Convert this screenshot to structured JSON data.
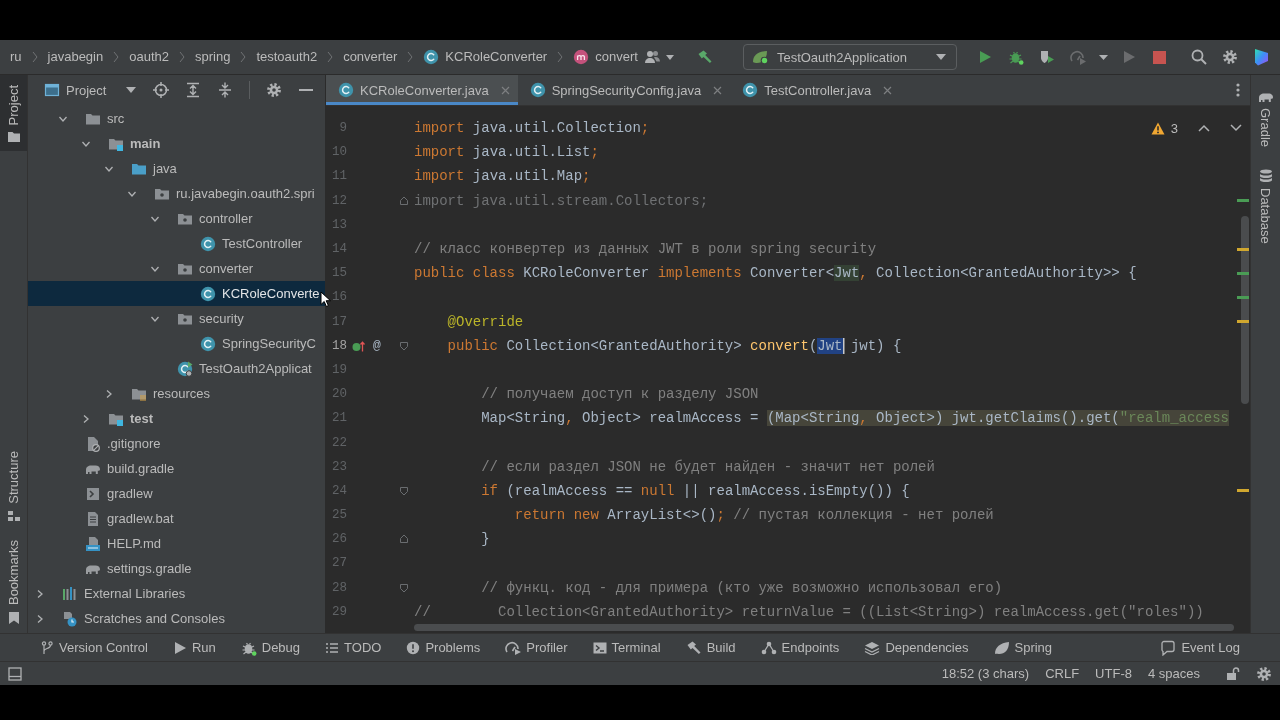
{
  "navigation_bar": {
    "breadcrumbs": [
      {
        "label": "ru",
        "kind": "package"
      },
      {
        "label": "javabegin",
        "kind": "package"
      },
      {
        "label": "oauth2",
        "kind": "package"
      },
      {
        "label": "spring",
        "kind": "package"
      },
      {
        "label": "testoauth2",
        "kind": "package"
      },
      {
        "label": "converter",
        "kind": "package"
      },
      {
        "label": "KCRoleConverter",
        "kind": "class"
      },
      {
        "label": "convert",
        "kind": "method"
      }
    ],
    "toolbar": [
      {
        "kind": "vcs-user",
        "disabled": false
      },
      {
        "kind": "build",
        "disabled": false
      },
      {
        "kind": "run-configuration",
        "label": "TestOauth2Application",
        "disabled": false
      },
      {
        "kind": "run",
        "disabled": false
      },
      {
        "kind": "debug",
        "disabled": false
      },
      {
        "kind": "coverage",
        "disabled": false
      },
      {
        "kind": "profile",
        "disabled": true
      },
      {
        "kind": "more",
        "disabled": false
      },
      {
        "kind": "attach",
        "disabled": true
      },
      {
        "kind": "stop",
        "disabled": false
      },
      {
        "kind": "search",
        "disabled": false
      },
      {
        "kind": "settings",
        "disabled": false
      },
      {
        "kind": "toolbox",
        "disabled": false
      }
    ]
  },
  "left_stripe": {
    "top": [
      {
        "label": "Project",
        "kind": "project",
        "selected": true
      }
    ],
    "bottom": [
      {
        "label": "Structure",
        "kind": "structure",
        "selected": false
      },
      {
        "label": "Bookmarks",
        "kind": "bookmarks",
        "selected": false
      }
    ]
  },
  "project_panel": {
    "title": "Project",
    "tree": {
      "items": [
        {
          "label": "src",
          "kind": "folder",
          "expanded": true,
          "selected": false,
          "children": [
            {
              "label": "main",
              "kind": "source-set",
              "expanded": true,
              "selected": false,
              "children": [
                {
                  "label": "java",
                  "kind": "java-root",
                  "expanded": true,
                  "selected": false,
                  "children": [
                    {
                      "label": "ru.javabegin.oauth2.spri",
                      "kind": "package",
                      "expanded": true,
                      "selected": false,
                      "children": [
                        {
                          "label": "controller",
                          "kind": "package",
                          "expanded": true,
                          "selected": false,
                          "children": [
                            {
                              "label": "TestController",
                              "kind": "class",
                              "selected": false
                            }
                          ]
                        },
                        {
                          "label": "converter",
                          "kind": "package",
                          "expanded": true,
                          "selected": false,
                          "children": [
                            {
                              "label": "KCRoleConverte",
                              "kind": "class",
                              "selected": true
                            }
                          ]
                        },
                        {
                          "label": "security",
                          "kind": "package",
                          "expanded": true,
                          "selected": false,
                          "children": [
                            {
                              "label": "SpringSecurityC",
                              "kind": "class",
                              "selected": false
                            }
                          ]
                        },
                        {
                          "label": "TestOauth2Applicat",
                          "kind": "app-class",
                          "selected": false
                        }
                      ]
                    }
                  ]
                },
                {
                  "label": "resources",
                  "kind": "resources-root",
                  "expanded": false,
                  "selected": false
                }
              ]
            },
            {
              "label": "test",
              "kind": "source-set",
              "expanded": false,
              "selected": false
            }
          ]
        },
        {
          "label": ".gitignore",
          "kind": "gitignore",
          "selected": false
        },
        {
          "label": "build.gradle",
          "kind": "gradle",
          "selected": false
        },
        {
          "label": "gradlew",
          "kind": "shell",
          "selected": false
        },
        {
          "label": "gradlew.bat",
          "kind": "batch",
          "selected": false
        },
        {
          "label": "HELP.md",
          "kind": "markdown",
          "selected": false
        },
        {
          "label": "settings.gradle",
          "kind": "gradle",
          "selected": false
        }
      ],
      "top_level": [
        {
          "label": "External Libraries",
          "kind": "libraries",
          "expanded": false,
          "selected": false
        },
        {
          "label": "Scratches and Consoles",
          "kind": "scratches",
          "expanded": false,
          "selected": false
        }
      ]
    }
  },
  "editor": {
    "tabs": [
      {
        "label": "KCRoleConverter.java",
        "selected": true
      },
      {
        "label": "SpringSecurityConfig.java",
        "selected": false
      },
      {
        "label": "TestController.java",
        "selected": false
      }
    ],
    "inspection_widget": {
      "warnings": "3"
    },
    "lines": [
      {
        "number": "9",
        "current": false,
        "tokens": [
          {
            "text": "import",
            "kind": "keyword"
          },
          {
            "text": " java.util.Collection",
            "kind": "plain"
          },
          {
            "text": ";",
            "kind": "keyword"
          }
        ]
      },
      {
        "number": "10",
        "current": false,
        "tokens": [
          {
            "text": "import",
            "kind": "keyword"
          },
          {
            "text": " java.util.List",
            "kind": "plain"
          },
          {
            "text": ";",
            "kind": "keyword"
          }
        ]
      },
      {
        "number": "11",
        "current": false,
        "tokens": [
          {
            "text": "import",
            "kind": "keyword"
          },
          {
            "text": " java.util.Map",
            "kind": "plain"
          },
          {
            "text": ";",
            "kind": "keyword"
          }
        ]
      },
      {
        "number": "12",
        "current": false,
        "fold_marker": {
          "kind": "end"
        },
        "stripe_mark": {
          "kind": "change"
        },
        "tokens": [
          {
            "text": "import java.util.stream.Collectors;",
            "kind": "unused"
          }
        ]
      },
      {
        "number": "13",
        "current": false
      },
      {
        "number": "14",
        "current": false,
        "stripe_mark": {
          "kind": "warning"
        },
        "tokens": [
          {
            "text": "// класс конвертер из данных JWT в роли spring security",
            "kind": "comment"
          }
        ]
      },
      {
        "number": "15",
        "current": false,
        "stripe_mark": {
          "kind": "change"
        },
        "tokens": [
          {
            "text": "public class",
            "kind": "keyword"
          },
          {
            "text": " KCRoleConverter ",
            "kind": "plain"
          },
          {
            "text": "implements",
            "kind": "keyword"
          },
          {
            "text": " Converter<",
            "kind": "plain"
          },
          {
            "text": "Jwt",
            "kind": "plain",
            "highlight": {
              "kind": "usage"
            }
          },
          {
            "text": ",",
            "kind": "keyword"
          },
          {
            "text": " Collection<GrantedAuthority>> {",
            "kind": "plain"
          }
        ]
      },
      {
        "number": "16",
        "current": false,
        "stripe_mark": {
          "kind": "change"
        }
      },
      {
        "number": "17",
        "current": false,
        "stripe_mark": {
          "kind": "warning"
        },
        "tokens": [
          {
            "text": "    @Override",
            "kind": "annotation"
          }
        ]
      },
      {
        "number": "18",
        "current": true,
        "fold_marker": {
          "kind": "start"
        },
        "gutter_icons": [
          {
            "kind": "implements"
          },
          {
            "kind": "glyph",
            "text": "@"
          }
        ],
        "tokens": [
          {
            "text": "    public",
            "kind": "keyword"
          },
          {
            "text": " Collection<GrantedAuthority> ",
            "kind": "plain"
          },
          {
            "text": "convert",
            "kind": "method"
          },
          {
            "text": "(",
            "kind": "plain"
          },
          {
            "text": "Jwt",
            "kind": "plain",
            "highlight": {
              "kind": "selection"
            }
          },
          {
            "text": " jwt) {",
            "kind": "plain"
          }
        ]
      },
      {
        "number": "19",
        "current": false
      },
      {
        "number": "20",
        "current": false,
        "tokens": [
          {
            "text": "        // получаем доступ к разделу JSON",
            "kind": "comment"
          }
        ]
      },
      {
        "number": "21",
        "current": false,
        "tokens": [
          {
            "text": "        Map<String",
            "kind": "plain"
          },
          {
            "text": ",",
            "kind": "keyword"
          },
          {
            "text": " Object> realmAccess = ",
            "kind": "plain"
          },
          {
            "text": "(Map<String",
            "kind": "plain",
            "highlight": {
              "kind": "warning"
            }
          },
          {
            "text": ",",
            "kind": "keyword",
            "highlight": {
              "kind": "warning"
            }
          },
          {
            "text": " Object>) jwt.getClaims().get(",
            "kind": "plain",
            "highlight": {
              "kind": "warning"
            }
          },
          {
            "text": "\"realm_access",
            "kind": "string",
            "highlight": {
              "kind": "warning"
            }
          }
        ]
      },
      {
        "number": "22",
        "current": false
      },
      {
        "number": "23",
        "current": false,
        "tokens": [
          {
            "text": "        // если раздел JSON не будет найден - значит нет ролей",
            "kind": "comment"
          }
        ]
      },
      {
        "number": "24",
        "current": false,
        "fold_marker": {
          "kind": "start"
        },
        "stripe_mark": {
          "kind": "warning"
        },
        "tokens": [
          {
            "text": "        if",
            "kind": "keyword"
          },
          {
            "text": " (realmAccess == ",
            "kind": "plain"
          },
          {
            "text": "null",
            "kind": "keyword"
          },
          {
            "text": " || realmAccess.isEmpty()) {",
            "kind": "plain"
          }
        ]
      },
      {
        "number": "25",
        "current": false,
        "tokens": [
          {
            "text": "            return new",
            "kind": "keyword"
          },
          {
            "text": " ArrayList<>()",
            "kind": "plain"
          },
          {
            "text": ";",
            "kind": "keyword"
          },
          {
            "text": " // пустая коллекция - нет ролей",
            "kind": "comment"
          }
        ]
      },
      {
        "number": "26",
        "current": false,
        "fold_marker": {
          "kind": "end"
        },
        "tokens": [
          {
            "text": "        }",
            "kind": "plain"
          }
        ]
      },
      {
        "number": "27",
        "current": false
      },
      {
        "number": "28",
        "current": false,
        "fold_marker": {
          "kind": "start"
        },
        "tokens": [
          {
            "text": "        // функц. код - для примера (кто уже возможно использовал его)",
            "kind": "comment"
          }
        ]
      },
      {
        "number": "29",
        "current": false,
        "tokens": [
          {
            "text": "//        Collection<GrantedAuthority> returnValue = ((List<String>) realmAccess.get(\"roles\"))",
            "kind": "comment"
          }
        ]
      }
    ]
  },
  "right_stripe": [
    {
      "label": "Gradle",
      "kind": "gradle",
      "selected": false
    },
    {
      "label": "Database",
      "kind": "database",
      "selected": false
    }
  ],
  "tool_window_bar": {
    "left": [
      {
        "label": "Version Control",
        "kind": "vcs"
      },
      {
        "label": "Run",
        "kind": "run"
      },
      {
        "label": "Debug",
        "kind": "debug"
      },
      {
        "label": "TODO",
        "kind": "todo"
      },
      {
        "label": "Problems",
        "kind": "problems"
      },
      {
        "label": "Profiler",
        "kind": "profiler"
      },
      {
        "label": "Terminal",
        "kind": "terminal"
      },
      {
        "label": "Build",
        "kind": "build"
      },
      {
        "label": "Endpoints",
        "kind": "endpoints"
      },
      {
        "label": "Dependencies",
        "kind": "dependencies"
      },
      {
        "label": "Spring",
        "kind": "spring"
      }
    ],
    "right": [
      {
        "label": "Event Log",
        "kind": "event-log"
      }
    ]
  },
  "status_bar": {
    "items": [
      {
        "label": "18:52 (3 chars)"
      },
      {
        "label": "CRLF"
      },
      {
        "label": "UTF-8"
      },
      {
        "label": "4 spaces"
      }
    ]
  }
}
